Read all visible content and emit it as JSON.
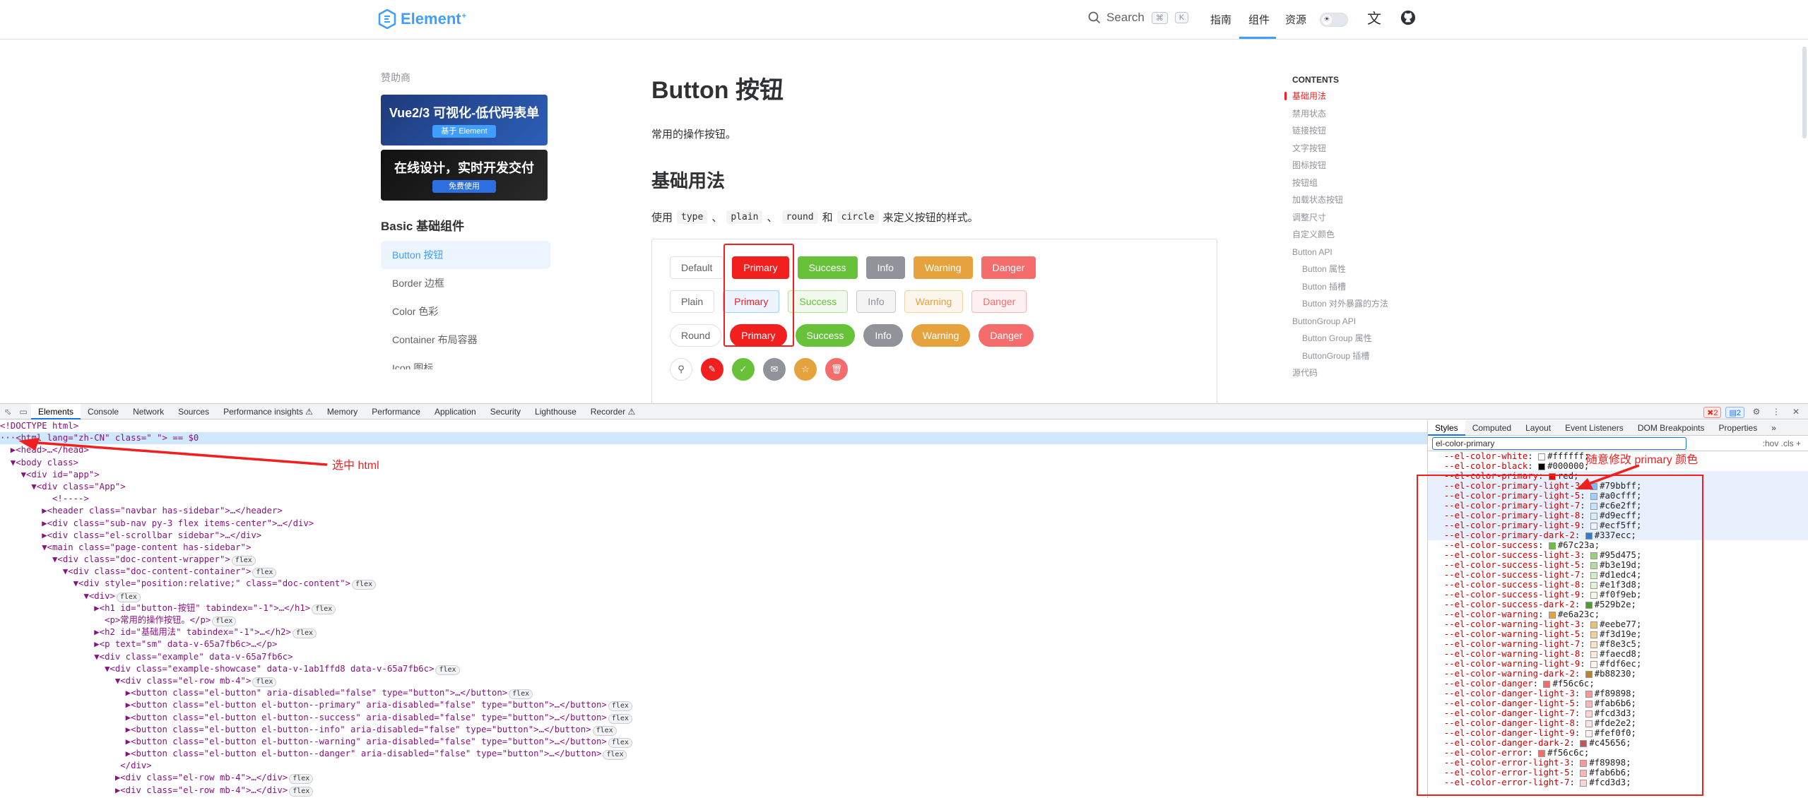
{
  "nav": {
    "logo_text": "Element",
    "logo_sup": "+",
    "search_label": "Search",
    "kbd1": "⌘",
    "kbd2": "K",
    "links": [
      "指南",
      "组件",
      "资源"
    ],
    "active_link": "组件",
    "lang_icon": "translate-icon",
    "github_icon": "github-icon"
  },
  "sidebar": {
    "sponsor_title": "赞助商",
    "banners": [
      {
        "title": "Vue2/3 可视化-低代码表单",
        "button": "基于 Element"
      },
      {
        "title": "在线设计，实时开发交付",
        "button": "免费使用"
      }
    ],
    "group_title": "Basic 基础组件",
    "items": [
      "Button 按钮",
      "Border 边框",
      "Color 色彩",
      "Container 布局容器",
      "Icon 图标"
    ]
  },
  "content": {
    "title": "Button 按钮",
    "desc": "常用的操作按钮。",
    "section_title": "基础用法",
    "usage_prefix": "使用",
    "usage_codes": [
      "type",
      "plain",
      "round",
      "circle"
    ],
    "usage_sep1": "、",
    "usage_sep2": "、",
    "usage_and": "和",
    "usage_suffix": "来定义按钮的样式。",
    "row1": [
      "Default",
      "Primary",
      "Success",
      "Info",
      "Warning",
      "Danger"
    ],
    "row2": [
      "Plain",
      "Primary",
      "Success",
      "Info",
      "Warning",
      "Danger"
    ],
    "row3": [
      "Round",
      "Primary",
      "Success",
      "Info",
      "Warning",
      "Danger"
    ],
    "row4_icons": [
      "search-icon",
      "edit-icon",
      "check-icon",
      "message-icon",
      "star-icon",
      "delete-icon"
    ]
  },
  "toc": {
    "title": "CONTENTS",
    "items": [
      "基础用法",
      "禁用状态",
      "链接按钮",
      "文字按钮",
      "图标按钮",
      "按钮组",
      "加载状态按钮",
      "调整尺寸",
      "自定义颜色",
      "Button API",
      "Button 属性",
      "Button 插槽",
      "Button 对外暴露的方法",
      "ButtonGroup API",
      "Button Group 属性",
      "ButtonGroup 插槽",
      "源代码"
    ]
  },
  "devtools": {
    "tabs": [
      "Elements",
      "Console",
      "Network",
      "Sources",
      "Performance insights ⚠",
      "Memory",
      "Performance",
      "Application",
      "Security",
      "Lighthouse",
      "Recorder ⚠"
    ],
    "active_tab": "Elements",
    "err_count": "2",
    "issue_count": "2",
    "styles_tabs": [
      "Styles",
      "Computed",
      "Layout",
      "Event Listeners",
      "DOM Breakpoints",
      "Properties",
      "»"
    ],
    "filter_value": "el-color-primary",
    "filter_right": ":hov  .cls  +",
    "dom_lines": [
      "<!DOCTYPE html>",
      "···<html lang=\"zh-CN\" class=\" \"> == $0",
      "  ▶<head>…</head>",
      "  ▼<body class>",
      "    ▼<div id=\"app\">",
      "      ▼<div class=\"App\">",
      "          <!---->",
      "        ▶<header class=\"navbar has-sidebar\">…</header>",
      "        ▶<div class=\"sub-nav py-3 flex items-center\">…</div>",
      "        ▶<div class=\"el-scrollbar sidebar\">…</div>",
      "        ▼<main class=\"page-content has-sidebar\">",
      "          ▼<div class=\"doc-content-wrapper\">",
      "            ▼<div class=\"doc-content-container\">",
      "              ▼<div style=\"position:relative;\" class=\"doc-content\">",
      "                ▼<div>",
      "                  ▶<h1 id=\"button-按钮\" tabindex=\"-1\">…</h1>",
      "                    <p>常用的操作按钮。</p>",
      "                  ▶<h2 id=\"基础用法\" tabindex=\"-1\">…</h2>",
      "                  ▶<p text=\"sm\" data-v-65a7fb6c>…</p>",
      "                  ▼<div class=\"example\" data-v-65a7fb6c>",
      "                    ▼<div class=\"example-showcase\" data-v-1ab1ffd8 data-v-65a7fb6c>",
      "                      ▼<div class=\"el-row mb-4\">",
      "                        ▶<button class=\"el-button\" aria-disabled=\"false\" type=\"button\">…</button>",
      "                        ▶<button class=\"el-button el-button--primary\" aria-disabled=\"false\" type=\"button\">…</button>",
      "                        ▶<button class=\"el-button el-button--success\" aria-disabled=\"false\" type=\"button\">…</button>",
      "                        ▶<button class=\"el-button el-button--info\" aria-disabled=\"false\" type=\"button\">…</button>",
      "                        ▶<button class=\"el-button el-button--warning\" aria-disabled=\"false\" type=\"button\">…</button>",
      "                        ▶<button class=\"el-button el-button--danger\" aria-disabled=\"false\" type=\"button\">…</button>",
      "                       </div>",
      "                      ▶<div class=\"el-row mb-4\">…</div>",
      "                      ▶<div class=\"el-row mb-4\">…</div>"
    ],
    "flex_badge": "flex",
    "annotation_select": "选中 html",
    "annotation_modify": "随意修改 primary 颜色",
    "css_vars": [
      {
        "name": "--el-color-white",
        "value": "#ffffff",
        "color": "#ffffff"
      },
      {
        "name": "--el-color-black",
        "value": "#000000",
        "color": "#000000"
      },
      {
        "name": "--el-color-primary",
        "value": "red",
        "color": "#ff0000",
        "hl": true
      },
      {
        "name": "--el-color-primary-light-3",
        "value": "#79bbff",
        "color": "#79bbff",
        "hl": true
      },
      {
        "name": "--el-color-primary-light-5",
        "value": "#a0cfff",
        "color": "#a0cfff",
        "hl": true
      },
      {
        "name": "--el-color-primary-light-7",
        "value": "#c6e2ff",
        "color": "#c6e2ff",
        "hl": true
      },
      {
        "name": "--el-color-primary-light-8",
        "value": "#d9ecff",
        "color": "#d9ecff",
        "hl": true
      },
      {
        "name": "--el-color-primary-light-9",
        "value": "#ecf5ff",
        "color": "#ecf5ff",
        "hl": true
      },
      {
        "name": "--el-color-primary-dark-2",
        "value": "#337ecc",
        "color": "#337ecc",
        "hl": true
      },
      {
        "name": "--el-color-success",
        "value": "#67c23a",
        "color": "#67c23a"
      },
      {
        "name": "--el-color-success-light-3",
        "value": "#95d475",
        "color": "#95d475"
      },
      {
        "name": "--el-color-success-light-5",
        "value": "#b3e19d",
        "color": "#b3e19d"
      },
      {
        "name": "--el-color-success-light-7",
        "value": "#d1edc4",
        "color": "#d1edc4"
      },
      {
        "name": "--el-color-success-light-8",
        "value": "#e1f3d8",
        "color": "#e1f3d8"
      },
      {
        "name": "--el-color-success-light-9",
        "value": "#f0f9eb",
        "color": "#f0f9eb"
      },
      {
        "name": "--el-color-success-dark-2",
        "value": "#529b2e",
        "color": "#529b2e"
      },
      {
        "name": "--el-color-warning",
        "value": "#e6a23c",
        "color": "#e6a23c"
      },
      {
        "name": "--el-color-warning-light-3",
        "value": "#eebe77",
        "color": "#eebe77"
      },
      {
        "name": "--el-color-warning-light-5",
        "value": "#f3d19e",
        "color": "#f3d19e"
      },
      {
        "name": "--el-color-warning-light-7",
        "value": "#f8e3c5",
        "color": "#f8e3c5"
      },
      {
        "name": "--el-color-warning-light-8",
        "value": "#faecd8",
        "color": "#faecd8"
      },
      {
        "name": "--el-color-warning-light-9",
        "value": "#fdf6ec",
        "color": "#fdf6ec"
      },
      {
        "name": "--el-color-warning-dark-2",
        "value": "#b88230",
        "color": "#b88230"
      },
      {
        "name": "--el-color-danger",
        "value": "#f56c6c",
        "color": "#f56c6c"
      },
      {
        "name": "--el-color-danger-light-3",
        "value": "#f89898",
        "color": "#f89898"
      },
      {
        "name": "--el-color-danger-light-5",
        "value": "#fab6b6",
        "color": "#fab6b6"
      },
      {
        "name": "--el-color-danger-light-7",
        "value": "#fcd3d3",
        "color": "#fcd3d3"
      },
      {
        "name": "--el-color-danger-light-8",
        "value": "#fde2e2",
        "color": "#fde2e2"
      },
      {
        "name": "--el-color-danger-light-9",
        "value": "#fef0f0",
        "color": "#fef0f0"
      },
      {
        "name": "--el-color-danger-dark-2",
        "value": "#c45656",
        "color": "#c45656"
      },
      {
        "name": "--el-color-error",
        "value": "#f56c6c",
        "color": "#f56c6c"
      },
      {
        "name": "--el-color-error-light-3",
        "value": "#f89898",
        "color": "#f89898"
      },
      {
        "name": "--el-color-error-light-5",
        "value": "#fab6b6",
        "color": "#fab6b6"
      },
      {
        "name": "--el-color-error-light-7",
        "value": "#fcd3d3",
        "color": "#fcd3d3"
      }
    ]
  },
  "colors": {
    "primary_override": "#f21f1f",
    "brand": "#409eff"
  }
}
